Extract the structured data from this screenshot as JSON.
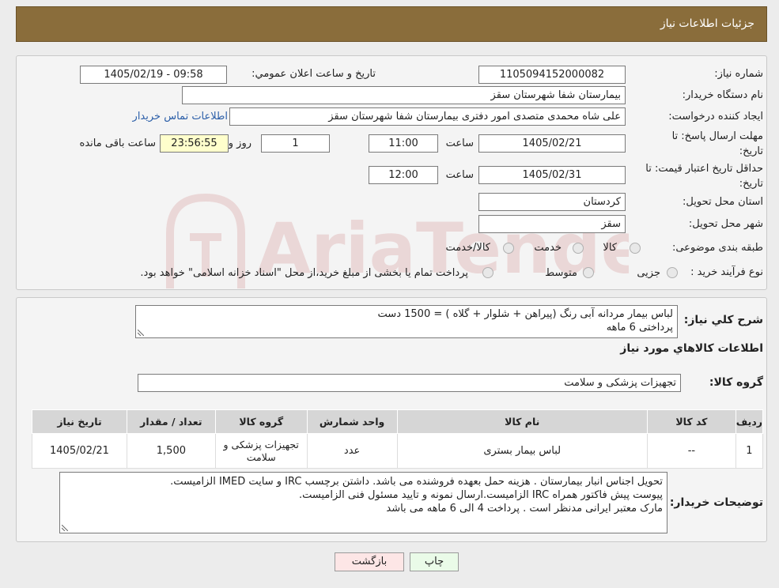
{
  "header": {
    "title": "جزئیات اطلاعات نیاز"
  },
  "form": {
    "need_number_label": "شماره نیاز:",
    "need_number": "1105094152000082",
    "announce_label": "تاریخ و ساعت اعلان عمومي:",
    "announce_value": "1405/02/19 - 09:58",
    "buyer_org_label": "نام دستگاه خریدار:",
    "buyer_org": "بیمارستان شفا شهرستان سقز",
    "requester_label": "ایجاد کننده درخواست:",
    "requester": "علی شاه محمدی متصدی امور دفتری بیمارستان شفا شهرستان سقز",
    "contact_link": "اطلاعات تماس خریدار",
    "deadline_label_1": "مهلت ارسال پاسخ: تا",
    "deadline_label_2": "تاریخ:",
    "deadline_date": "1405/02/21",
    "time_label": "ساعت",
    "deadline_time": "11:00",
    "days": "1",
    "days_label": "روز و",
    "remaining": "23:56:55",
    "remaining_label": "ساعت باقی مانده",
    "validity_label_1": "حداقل تاریخ اعتبار قیمت: تا",
    "validity_label_2": "تاریخ:",
    "validity_date": "1405/02/31",
    "validity_time": "12:00",
    "province_label": "استان محل تحویل:",
    "province": "کردستان",
    "city_label": "شهر محل تحویل:",
    "city": "سقز",
    "category_label": "طبقه بندی موضوعی:",
    "cat_goods": "کالا",
    "cat_service": "خدمت",
    "cat_both": "کالا/خدمت",
    "process_label": "نوع فرآیند خرید :",
    "proc_partial": "جزیی",
    "proc_medium": "متوسط",
    "proc_note": "پرداخت تمام یا بخشی از مبلغ خرید،از محل \"اسناد خزانه اسلامی\" خواهد بود."
  },
  "summary": {
    "label": "شرح کلي نياز:",
    "line1": "لباس بیمار مردانه آبی رنگ (پیراهن + شلوار + گلاه ) = 1500 دست",
    "line2": "پرداختی 6 ماهه",
    "goods_info_title": "اطلاعات کالاهاي مورد نياز",
    "group_label": "گروه کالا:",
    "group_value": "تجهیزات پزشکی و سلامت"
  },
  "table": {
    "headers": [
      "ردیف",
      "کد کالا",
      "نام کالا",
      "واحد شمارش",
      "گروه کالا",
      "تعداد / مقدار",
      "تاریخ نیاز"
    ],
    "rows": [
      {
        "row": "1",
        "code": "--",
        "name": "لباس بیمار بستری",
        "unit": "عدد",
        "group": "تجهیزات پزشکی و سلامت",
        "qty": "1,500",
        "date": "1405/02/21"
      }
    ]
  },
  "notes": {
    "label": "توضیحات خریدار:",
    "line1": "تحویل اجناس  انبار بیمارستان . هزینه حمل بعهده فروشنده می باشد.  داشتن برچسب IRC  و سایت  IMED  الزامیست.",
    "line2": "پیوست پیش فاکتور همراه IRC  الزامیست.ارسال نمونه و تایید مسئول فنی الزامیست.",
    "line3": "مارک معتبر ایرانی مدنظر است . پرداخت 4 الی 6 ماهه می باشد"
  },
  "buttons": {
    "print": "چاپ",
    "back": "بازگشت"
  },
  "watermark": {
    "text": "AriaTender.neT"
  }
}
